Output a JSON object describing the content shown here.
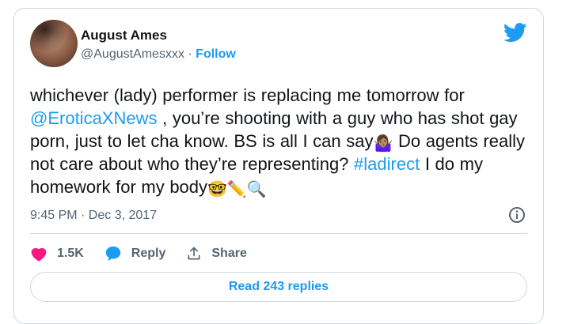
{
  "tweet": {
    "author": {
      "name": "August Ames",
      "handle": "@AugustAmesxxx",
      "separator": " · ",
      "follow_label": "Follow"
    },
    "text": {
      "part1": "whichever (lady) performer is replacing me tomorrow for ",
      "mention": "@EroticaXNews",
      "part2": " , you’re shooting with a guy who has shot gay porn, just to let cha know.  BS is all I can say",
      "emoji1": "🤷🏽‍♀️",
      "part3": " Do agents really not care about who they’re representing? ",
      "hashtag": "#ladirect",
      "part4": " I do my homework for my body",
      "emoji2": "🤓✏️🔍"
    },
    "timestamp": "9:45 PM · Dec 3, 2017",
    "actions": {
      "like_count": "1.5K",
      "reply_label": "Reply",
      "share_label": "Share"
    },
    "read_replies_label": "Read 243 replies"
  },
  "colors": {
    "accent": "#1d9bf0",
    "like": "#f91880",
    "muted": "#536471",
    "border": "#cfd9de"
  },
  "icons": [
    "twitter-bird-icon",
    "info-icon",
    "heart-icon",
    "reply-bubble-icon",
    "share-icon"
  ]
}
